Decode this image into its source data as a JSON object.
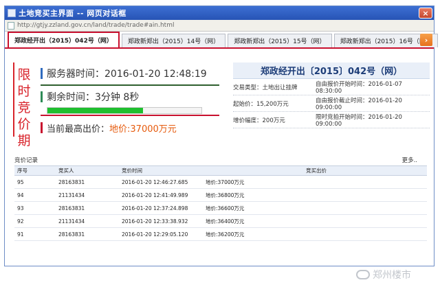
{
  "window": {
    "title": "土地竞买主界面 -- 网页对话框",
    "address": "http://gtjy.zzland.gov.cn/land/trade/trade#ain.html"
  },
  "tabs": [
    {
      "label": "郑政经开出（2015）042号（网）",
      "active": true
    },
    {
      "label": "郑政新郑出（2015）14号（网）",
      "active": false
    },
    {
      "label": "郑政新郑出（2015）15号（网）",
      "active": false
    },
    {
      "label": "郑政新郑出（2015）16号（网）",
      "active": false
    }
  ],
  "tab_scroll_glyph": "›",
  "vertical_label": "限时竞价期",
  "info": {
    "server_time": "服务器时间：2016-01-20 12:48:19",
    "remaining_time": "剩余时间：3分钟 8秒",
    "remaining_progress": 0.62,
    "highest_label": "当前最高出价：",
    "highest_value": "地价:37000万元"
  },
  "detail": {
    "header": "郑政经开出〔2015〕042号（网）",
    "rows": [
      {
        "left": "交易类型：土地出让挂牌",
        "right": "自由报价开始时间：2016-01-07 08:30:00"
      },
      {
        "left": "起始价：15,200万元",
        "right": "自由报价截止时间：2016-01-20 09:00:00"
      },
      {
        "left": "增价幅度：200万元",
        "right": "限时竞拍开始时间：2016-01-20 09:00:00"
      }
    ]
  },
  "records": {
    "title": "竞价记录",
    "more": "更多..",
    "columns": [
      "序号",
      "竞买人",
      "竞价时间",
      "竞买出价"
    ],
    "rows": [
      [
        "95",
        "28163831",
        "2016-01-20 12:46:27.685",
        "地价:37000万元"
      ],
      [
        "94",
        "21131434",
        "2016-01-20 12:41:49.989",
        "地价:36800万元"
      ],
      [
        "93",
        "28163831",
        "2016-01-20 12:37:24.898",
        "地价:36600万元"
      ],
      [
        "92",
        "21131434",
        "2016-01-20 12:33:38.932",
        "地价:36400万元"
      ],
      [
        "91",
        "28163831",
        "2016-01-20 12:29:05.120",
        "地价:36200万元"
      ]
    ]
  },
  "watermark": "郑州楼市",
  "colors": {
    "accent_red": "#c8102e",
    "progress_green": "#1fbf2f",
    "price_orange": "#e65a0c"
  }
}
